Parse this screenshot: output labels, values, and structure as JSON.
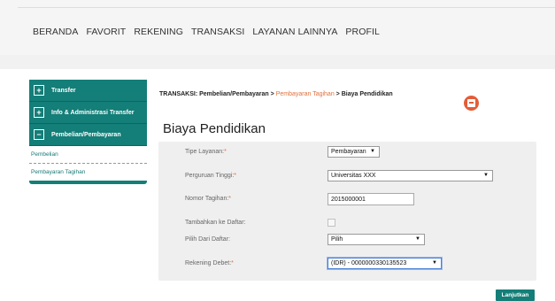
{
  "nav": [
    "BERANDA",
    "FAVORIT",
    "REKENING",
    "TRANSAKSI",
    "LAYANAN LAINNYA",
    "PROFIL"
  ],
  "sidebar": {
    "items": [
      {
        "icon": "+",
        "label": "Transfer"
      },
      {
        "icon": "+",
        "label": "Info & Administrasi Transfer"
      },
      {
        "icon": "−",
        "label": "Pembelian/Pembayaran"
      }
    ],
    "subitems": [
      "Pembelian",
      "Pembayaran Tagihan"
    ]
  },
  "breadcrumb": {
    "prefix": "TRANSAKSI: Pembelian/Pembayaran > ",
    "middle": "Pembayaran Tagihan",
    "suffix": " > Biaya Pendidikan"
  },
  "page_title": "Biaya Pendidikan",
  "form": {
    "tipe_layanan": {
      "label": "Tipe Layanan:",
      "req": "*",
      "value": "Pembayaran"
    },
    "perguruan": {
      "label": "Perguruan Tinggi:",
      "req": "*",
      "value": "Universitas XXX"
    },
    "nomor": {
      "label": "Nomor Tagihan:",
      "req": "*",
      "value": "2015000001"
    },
    "tambahkan": {
      "label": "Tambahkan ke Daftar:"
    },
    "pilih": {
      "label": "Pilih Dari Daftar:",
      "value": "Pilih"
    },
    "rekening": {
      "label": "Rekening Debet:",
      "req": "*",
      "value": "(IDR) - 0000000330135523"
    }
  },
  "submit_label": "Lanjutkan",
  "colors": {
    "brand": "#147e78",
    "accent": "#e0703a",
    "print": "#e45c37"
  }
}
